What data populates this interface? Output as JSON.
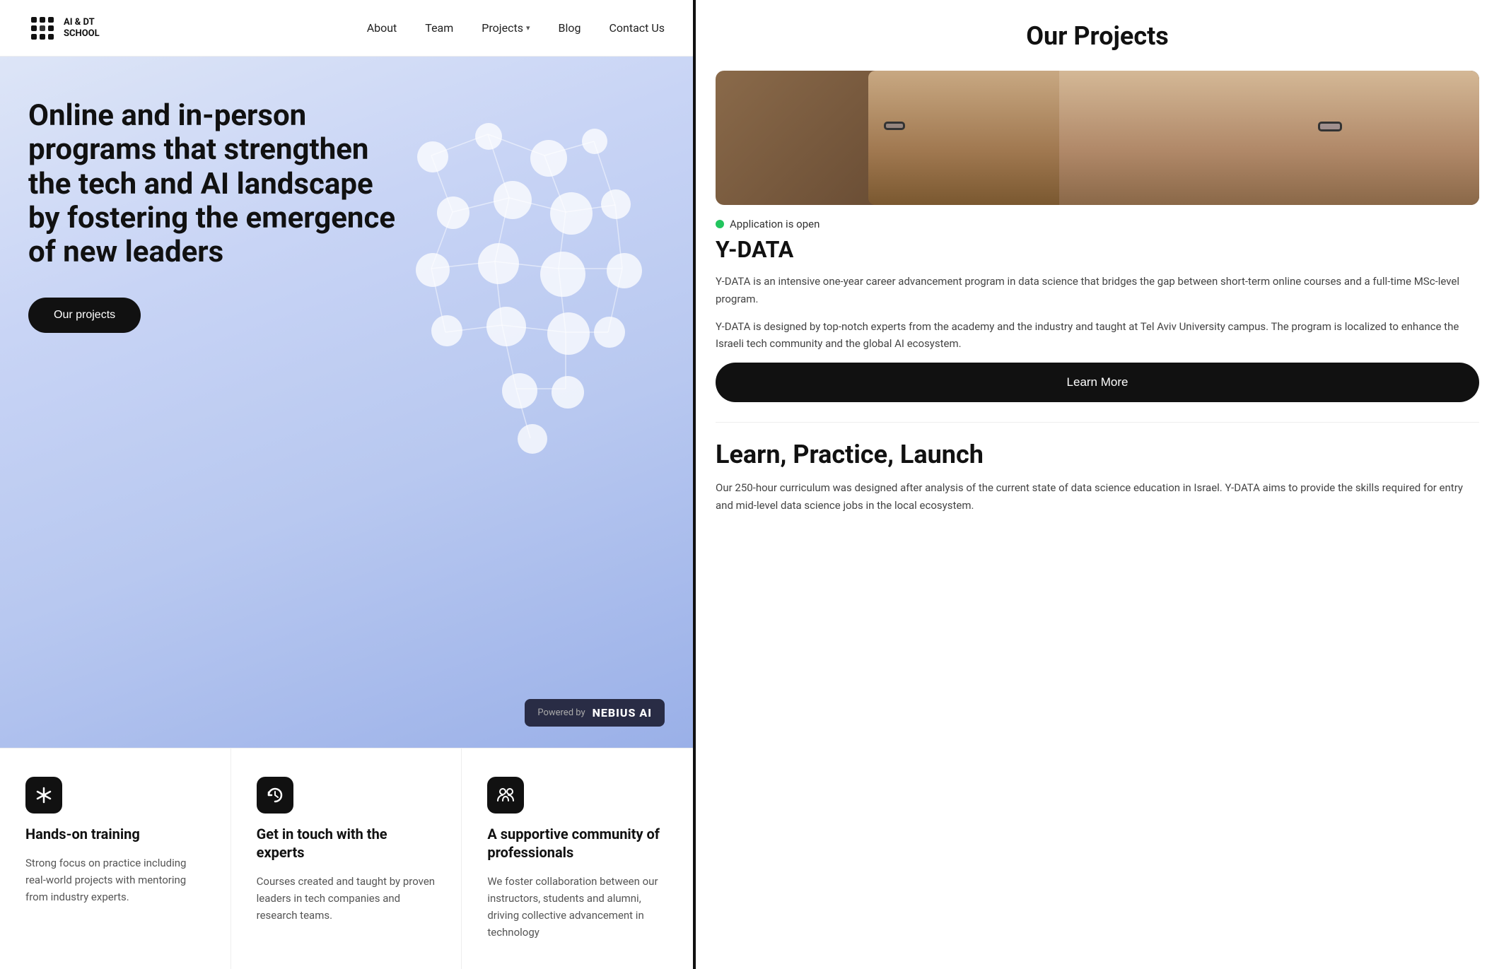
{
  "nav": {
    "logo_line1": "AI & DT",
    "logo_line2": "SCHOOL",
    "links": [
      {
        "label": "About",
        "has_dropdown": false
      },
      {
        "label": "Team",
        "has_dropdown": false
      },
      {
        "label": "Projects",
        "has_dropdown": true
      },
      {
        "label": "Blog",
        "has_dropdown": false
      },
      {
        "label": "Contact Us",
        "has_dropdown": false
      }
    ]
  },
  "hero": {
    "title": "Online and in-person programs that strengthen the tech and AI landscape by fostering the emergence of new leaders",
    "cta_label": "Our projects",
    "powered_by_prefix": "Powered by",
    "powered_by_brand": "NEBIUS AI"
  },
  "features": [
    {
      "id": "hands-on",
      "title": "Hands-on training",
      "desc": "Strong focus on practice including real-world projects with mentoring from industry experts.",
      "icon": "asterisk"
    },
    {
      "id": "experts",
      "title": "Get in touch with the experts",
      "desc": "Courses created and taught by proven leaders in tech companies and research teams.",
      "icon": "refresh"
    },
    {
      "id": "community",
      "title": "A supportive community of professionals",
      "desc": "We foster collaboration between our instructors, students and alumni, driving collective advancement in technology",
      "icon": "users"
    }
  ],
  "sidebar": {
    "title": "Our Projects",
    "project": {
      "status_label": "Application is open",
      "name": "Y-DATA",
      "desc1": "Y-DATA is an intensive one-year career advancement program in data science that bridges the gap between short-term online courses and a full-time MSc-level program.",
      "desc2": "Y-DATA is designed by top-notch experts from the academy and the industry and taught at Tel Aviv University campus. The program is localized to enhance the Israeli tech community and the global AI ecosystem.",
      "learn_more_label": "Learn More"
    },
    "second_section": {
      "heading": "Learn, Practice, Launch",
      "desc": "Our 250-hour curriculum was designed after analysis of the current state of data science education in Israel. Y-DATA aims to provide the skills required for entry and mid-level data science jobs in the local ecosystem."
    }
  }
}
